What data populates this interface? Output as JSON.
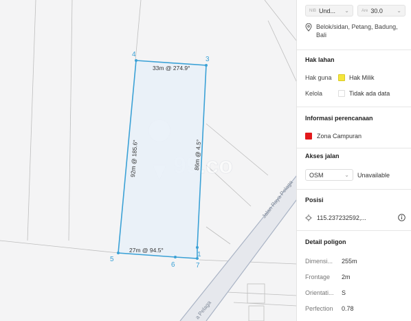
{
  "map": {
    "watermark": "99.co",
    "street_label": "Jalan Raya Pelaga",
    "street_label_lower": "a Pelaga",
    "edge_labels": [
      "33m @ 274.9°",
      "92m @ 185.6°",
      "86m @ 4.5°",
      "27m @ 94.5°"
    ],
    "vertex_labels": [
      "1",
      "3",
      "4",
      "5",
      "6",
      "7"
    ],
    "colors": {
      "parcel_stroke": "#3aa1d6",
      "parcel_fill": "#e9f1f8",
      "vertex_label": "#3aa1d6"
    }
  },
  "panel": {
    "top": {
      "nib_tag": "NIB",
      "nib_value": "Und...",
      "area_tag": "Are",
      "area_value": "30.0",
      "location_icon": "location-pin-icon",
      "location": "Belok/sidan, Petang, Badung, Bali"
    },
    "hak_lahan": {
      "title": "Hak lahan",
      "rows": [
        {
          "label": "Hak guna",
          "swatch": "#f5e63c",
          "value": "Hak Milik"
        },
        {
          "label": "Kelola",
          "swatch": "#ffffff",
          "value": "Tidak ada data"
        }
      ]
    },
    "perencanaan": {
      "title": "Informasi perencanaan",
      "zona_color": "#e2191b",
      "zona": "Zona Campuran"
    },
    "akses": {
      "title": "Akses jalan",
      "select_value": "OSM",
      "status": "Unavailable"
    },
    "posisi": {
      "title": "Posisi",
      "icon": "crosshair-icon",
      "coord": "115.237232592,...",
      "info_icon": "info-icon"
    },
    "detail": {
      "title": "Detail poligon",
      "rows": [
        {
          "k": "Dimensi...",
          "v": "255m"
        },
        {
          "k": "Frontage",
          "v": "2m"
        },
        {
          "k": "Orientati...",
          "v": "S"
        },
        {
          "k": "Perfection",
          "v": "0.78"
        }
      ]
    }
  }
}
